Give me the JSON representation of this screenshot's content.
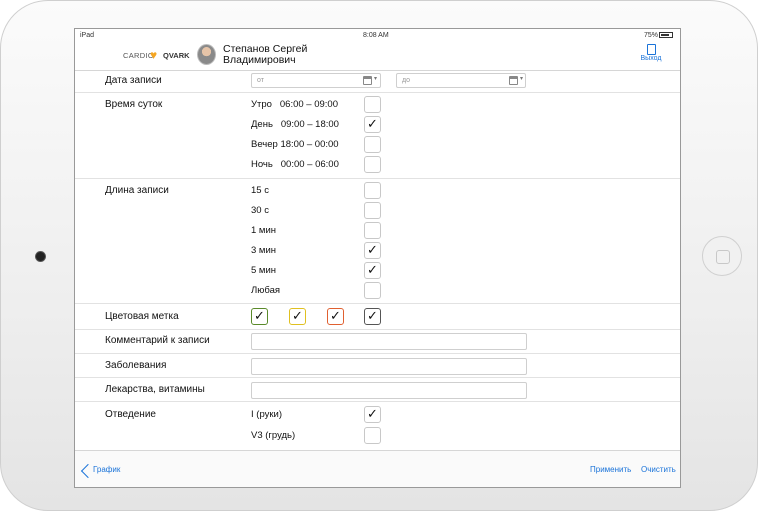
{
  "status_bar": {
    "carrier": "iPad",
    "time": "8:08 AM",
    "battery": "75%"
  },
  "header": {
    "logo_left": "CARDIO",
    "logo_right": "QVARK",
    "user_name": "Степанов Сергей Владимирович",
    "exit_label": "Выход"
  },
  "filters": {
    "date": {
      "label": "Дата записи",
      "from_placeholder": "от",
      "to_placeholder": "до"
    },
    "time_of_day": {
      "label": "Время суток",
      "options": [
        {
          "label": "Утро   06:00 – 09:00",
          "checked": false
        },
        {
          "label": "День   09:00 – 18:00",
          "checked": true
        },
        {
          "label": "Вечер 18:00 – 00:00",
          "checked": false
        },
        {
          "label": "Ночь   00:00 – 06:00",
          "checked": false
        }
      ]
    },
    "record_length": {
      "label": "Длина записи",
      "options": [
        {
          "label": "15 с",
          "checked": false
        },
        {
          "label": "30 с",
          "checked": false
        },
        {
          "label": "1 мин",
          "checked": false
        },
        {
          "label": "3 мин",
          "checked": true
        },
        {
          "label": "5 мин",
          "checked": true
        },
        {
          "label": "Любая",
          "checked": false
        }
      ]
    },
    "color_mark": {
      "label": "Цветовая метка",
      "colors": [
        {
          "color": "#5a8a2a",
          "checked": true
        },
        {
          "color": "#e0c020",
          "checked": true
        },
        {
          "color": "#e06030",
          "checked": true
        },
        {
          "color": "#555555",
          "checked": true
        }
      ]
    },
    "comment": {
      "label": "Комментарий к записи",
      "value": ""
    },
    "diseases": {
      "label": "Заболевания",
      "value": ""
    },
    "medicines": {
      "label": "Лекарства, витамины",
      "value": ""
    },
    "lead": {
      "label": "Отведение",
      "options": [
        {
          "label": "I (руки)",
          "checked": true
        },
        {
          "label": "V3 (грудь)",
          "checked": false
        }
      ]
    }
  },
  "toolbar": {
    "back_label": "График",
    "apply_label": "Применить",
    "clear_label": "Очистить"
  },
  "colors": {
    "accent": "#1a73d9"
  }
}
